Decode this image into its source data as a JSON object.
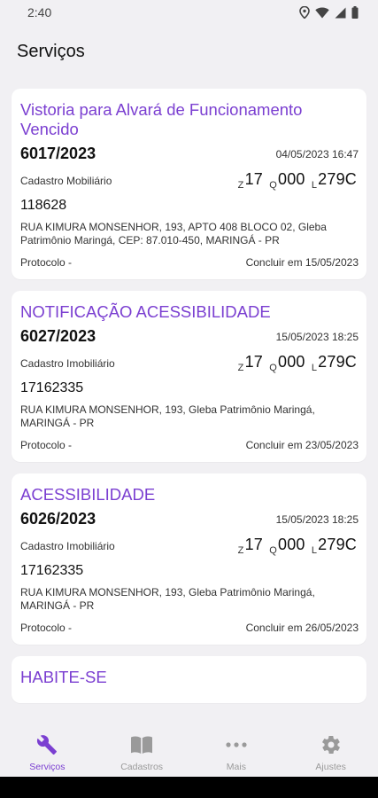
{
  "status": {
    "time": "2:40"
  },
  "header": {
    "title": "Serviços"
  },
  "cards": [
    {
      "title": "Vistoria para Alvará de Funcionamento Vencido",
      "number": "6017/2023",
      "datetime": "04/05/2023 16:47",
      "cadastro_type": "Cadastro Mobiliário",
      "zona": "17",
      "quadra": "000",
      "lote": "279C",
      "inscricao": "118628",
      "address": "RUA KIMURA MONSENHOR, 193, APTO 408 BLOCO 02, Gleba Patrimônio Maringá, CEP: 87.010-450, MARINGÁ - PR",
      "protocolo": "Protocolo -",
      "concluir": "Concluir em 15/05/2023"
    },
    {
      "title": "NOTIFICAÇÃO ACESSIBILIDADE",
      "number": "6027/2023",
      "datetime": "15/05/2023 18:25",
      "cadastro_type": "Cadastro Imobiliário",
      "zona": "17",
      "quadra": "000",
      "lote": "279C",
      "inscricao": "17162335",
      "address": "RUA KIMURA MONSENHOR, 193, Gleba Patrimônio Maringá, MARINGÁ - PR",
      "protocolo": "Protocolo -",
      "concluir": "Concluir em 23/05/2023"
    },
    {
      "title": "ACESSIBILIDADE",
      "number": "6026/2023",
      "datetime": "15/05/2023 18:25",
      "cadastro_type": "Cadastro Imobiliário",
      "zona": "17",
      "quadra": "000",
      "lote": "279C",
      "inscricao": "17162335",
      "address": "RUA KIMURA MONSENHOR, 193, Gleba Patrimônio Maringá, MARINGÁ - PR",
      "protocolo": "Protocolo -",
      "concluir": "Concluir em 26/05/2023"
    },
    {
      "title": "HABITE-SE"
    }
  ],
  "zql_labels": {
    "z": "Z",
    "q": "Q",
    "l": "L"
  },
  "nav": [
    {
      "label": "Serviços",
      "icon": "wrench-icon",
      "active": true
    },
    {
      "label": "Cadastros",
      "icon": "book-icon",
      "active": false
    },
    {
      "label": "Mais",
      "icon": "more-dots-icon",
      "active": false
    },
    {
      "label": "Ajustes",
      "icon": "gear-icon",
      "active": false
    }
  ],
  "colors": {
    "accent": "#7b3fd1",
    "background": "#f1f0f3",
    "card": "#ffffff",
    "inactive": "#9a9a9a"
  }
}
